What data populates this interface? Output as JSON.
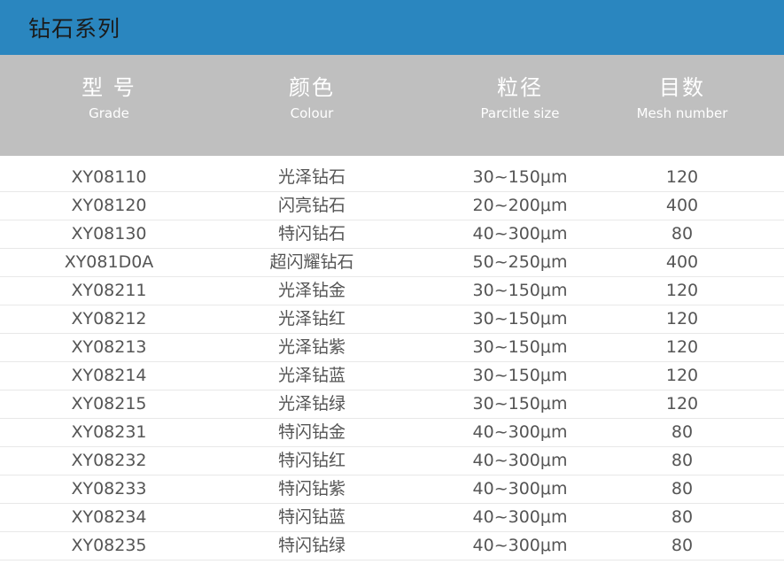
{
  "title": "钻石系列",
  "columns": [
    {
      "zh": "型 号",
      "en": "Grade"
    },
    {
      "zh": "颜色",
      "en": "Colour"
    },
    {
      "zh": "粒径",
      "en": "Parcitle size"
    },
    {
      "zh": "目数",
      "en": "Mesh number"
    }
  ],
  "rows": [
    [
      "XY08110",
      "光泽钻石",
      "30~150μm",
      "120"
    ],
    [
      "XY08120",
      "闪亮钻石",
      "20~200μm",
      "400"
    ],
    [
      "XY08130",
      "特闪钻石",
      "40~300μm",
      "80"
    ],
    [
      "XY081D0A",
      "超闪耀钻石",
      "50~250μm",
      "400"
    ],
    [
      "XY08211",
      "光泽钻金",
      "30~150μm",
      "120"
    ],
    [
      "XY08212",
      "光泽钻红",
      "30~150μm",
      "120"
    ],
    [
      "XY08213",
      "光泽钻紫",
      "30~150μm",
      "120"
    ],
    [
      "XY08214",
      "光泽钻蓝",
      "30~150μm",
      "120"
    ],
    [
      "XY08215",
      "光泽钻绿",
      "30~150μm",
      "120"
    ],
    [
      "XY08231",
      "特闪钻金",
      "40~300μm",
      "80"
    ],
    [
      "XY08232",
      "特闪钻红",
      "40~300μm",
      "80"
    ],
    [
      "XY08233",
      "特闪钻紫",
      "40~300μm",
      "80"
    ],
    [
      "XY08234",
      "特闪钻蓝",
      "40~300μm",
      "80"
    ],
    [
      "XY08235",
      "特闪钻绿",
      "40~300μm",
      "80"
    ]
  ],
  "colors": {
    "title_bar": "#2a86bf",
    "header_bg": "#bfbfbf",
    "cell_text": "#555555"
  }
}
